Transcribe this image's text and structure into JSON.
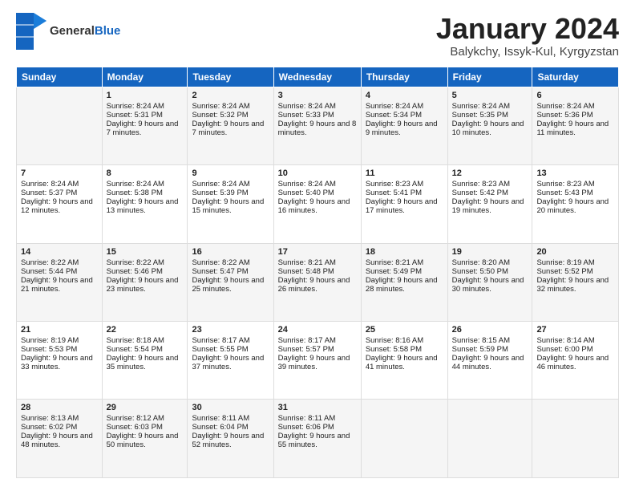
{
  "header": {
    "logo_general": "General",
    "logo_blue": "Blue",
    "month_title": "January 2024",
    "location": "Balykchy, Issyk-Kul, Kyrgyzstan"
  },
  "days_of_week": [
    "Sunday",
    "Monday",
    "Tuesday",
    "Wednesday",
    "Thursday",
    "Friday",
    "Saturday"
  ],
  "weeks": [
    [
      {
        "day": "",
        "sunrise": "",
        "sunset": "",
        "daylight": ""
      },
      {
        "day": "1",
        "sunrise": "Sunrise: 8:24 AM",
        "sunset": "Sunset: 5:31 PM",
        "daylight": "Daylight: 9 hours and 7 minutes."
      },
      {
        "day": "2",
        "sunrise": "Sunrise: 8:24 AM",
        "sunset": "Sunset: 5:32 PM",
        "daylight": "Daylight: 9 hours and 7 minutes."
      },
      {
        "day": "3",
        "sunrise": "Sunrise: 8:24 AM",
        "sunset": "Sunset: 5:33 PM",
        "daylight": "Daylight: 9 hours and 8 minutes."
      },
      {
        "day": "4",
        "sunrise": "Sunrise: 8:24 AM",
        "sunset": "Sunset: 5:34 PM",
        "daylight": "Daylight: 9 hours and 9 minutes."
      },
      {
        "day": "5",
        "sunrise": "Sunrise: 8:24 AM",
        "sunset": "Sunset: 5:35 PM",
        "daylight": "Daylight: 9 hours and 10 minutes."
      },
      {
        "day": "6",
        "sunrise": "Sunrise: 8:24 AM",
        "sunset": "Sunset: 5:36 PM",
        "daylight": "Daylight: 9 hours and 11 minutes."
      }
    ],
    [
      {
        "day": "7",
        "sunrise": "Sunrise: 8:24 AM",
        "sunset": "Sunset: 5:37 PM",
        "daylight": "Daylight: 9 hours and 12 minutes."
      },
      {
        "day": "8",
        "sunrise": "Sunrise: 8:24 AM",
        "sunset": "Sunset: 5:38 PM",
        "daylight": "Daylight: 9 hours and 13 minutes."
      },
      {
        "day": "9",
        "sunrise": "Sunrise: 8:24 AM",
        "sunset": "Sunset: 5:39 PM",
        "daylight": "Daylight: 9 hours and 15 minutes."
      },
      {
        "day": "10",
        "sunrise": "Sunrise: 8:24 AM",
        "sunset": "Sunset: 5:40 PM",
        "daylight": "Daylight: 9 hours and 16 minutes."
      },
      {
        "day": "11",
        "sunrise": "Sunrise: 8:23 AM",
        "sunset": "Sunset: 5:41 PM",
        "daylight": "Daylight: 9 hours and 17 minutes."
      },
      {
        "day": "12",
        "sunrise": "Sunrise: 8:23 AM",
        "sunset": "Sunset: 5:42 PM",
        "daylight": "Daylight: 9 hours and 19 minutes."
      },
      {
        "day": "13",
        "sunrise": "Sunrise: 8:23 AM",
        "sunset": "Sunset: 5:43 PM",
        "daylight": "Daylight: 9 hours and 20 minutes."
      }
    ],
    [
      {
        "day": "14",
        "sunrise": "Sunrise: 8:22 AM",
        "sunset": "Sunset: 5:44 PM",
        "daylight": "Daylight: 9 hours and 21 minutes."
      },
      {
        "day": "15",
        "sunrise": "Sunrise: 8:22 AM",
        "sunset": "Sunset: 5:46 PM",
        "daylight": "Daylight: 9 hours and 23 minutes."
      },
      {
        "day": "16",
        "sunrise": "Sunrise: 8:22 AM",
        "sunset": "Sunset: 5:47 PM",
        "daylight": "Daylight: 9 hours and 25 minutes."
      },
      {
        "day": "17",
        "sunrise": "Sunrise: 8:21 AM",
        "sunset": "Sunset: 5:48 PM",
        "daylight": "Daylight: 9 hours and 26 minutes."
      },
      {
        "day": "18",
        "sunrise": "Sunrise: 8:21 AM",
        "sunset": "Sunset: 5:49 PM",
        "daylight": "Daylight: 9 hours and 28 minutes."
      },
      {
        "day": "19",
        "sunrise": "Sunrise: 8:20 AM",
        "sunset": "Sunset: 5:50 PM",
        "daylight": "Daylight: 9 hours and 30 minutes."
      },
      {
        "day": "20",
        "sunrise": "Sunrise: 8:19 AM",
        "sunset": "Sunset: 5:52 PM",
        "daylight": "Daylight: 9 hours and 32 minutes."
      }
    ],
    [
      {
        "day": "21",
        "sunrise": "Sunrise: 8:19 AM",
        "sunset": "Sunset: 5:53 PM",
        "daylight": "Daylight: 9 hours and 33 minutes."
      },
      {
        "day": "22",
        "sunrise": "Sunrise: 8:18 AM",
        "sunset": "Sunset: 5:54 PM",
        "daylight": "Daylight: 9 hours and 35 minutes."
      },
      {
        "day": "23",
        "sunrise": "Sunrise: 8:17 AM",
        "sunset": "Sunset: 5:55 PM",
        "daylight": "Daylight: 9 hours and 37 minutes."
      },
      {
        "day": "24",
        "sunrise": "Sunrise: 8:17 AM",
        "sunset": "Sunset: 5:57 PM",
        "daylight": "Daylight: 9 hours and 39 minutes."
      },
      {
        "day": "25",
        "sunrise": "Sunrise: 8:16 AM",
        "sunset": "Sunset: 5:58 PM",
        "daylight": "Daylight: 9 hours and 41 minutes."
      },
      {
        "day": "26",
        "sunrise": "Sunrise: 8:15 AM",
        "sunset": "Sunset: 5:59 PM",
        "daylight": "Daylight: 9 hours and 44 minutes."
      },
      {
        "day": "27",
        "sunrise": "Sunrise: 8:14 AM",
        "sunset": "Sunset: 6:00 PM",
        "daylight": "Daylight: 9 hours and 46 minutes."
      }
    ],
    [
      {
        "day": "28",
        "sunrise": "Sunrise: 8:13 AM",
        "sunset": "Sunset: 6:02 PM",
        "daylight": "Daylight: 9 hours and 48 minutes."
      },
      {
        "day": "29",
        "sunrise": "Sunrise: 8:12 AM",
        "sunset": "Sunset: 6:03 PM",
        "daylight": "Daylight: 9 hours and 50 minutes."
      },
      {
        "day": "30",
        "sunrise": "Sunrise: 8:11 AM",
        "sunset": "Sunset: 6:04 PM",
        "daylight": "Daylight: 9 hours and 52 minutes."
      },
      {
        "day": "31",
        "sunrise": "Sunrise: 8:11 AM",
        "sunset": "Sunset: 6:06 PM",
        "daylight": "Daylight: 9 hours and 55 minutes."
      },
      {
        "day": "",
        "sunrise": "",
        "sunset": "",
        "daylight": ""
      },
      {
        "day": "",
        "sunrise": "",
        "sunset": "",
        "daylight": ""
      },
      {
        "day": "",
        "sunrise": "",
        "sunset": "",
        "daylight": ""
      }
    ]
  ]
}
